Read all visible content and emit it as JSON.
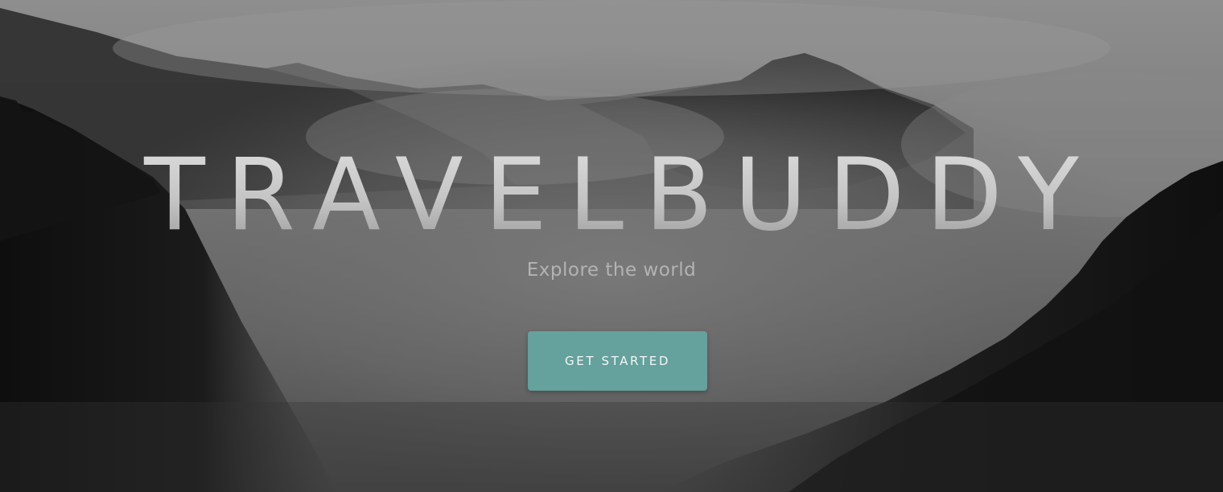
{
  "hero": {
    "title": "TRAVELBUDDY",
    "tagline": "Explore the world",
    "cta_label": "GET STARTED"
  },
  "colors": {
    "button_background": "#65a19d",
    "button_text": "#f2f7f6",
    "title_text": "#cfcfcf",
    "tagline_text": "#b3b3b3"
  }
}
